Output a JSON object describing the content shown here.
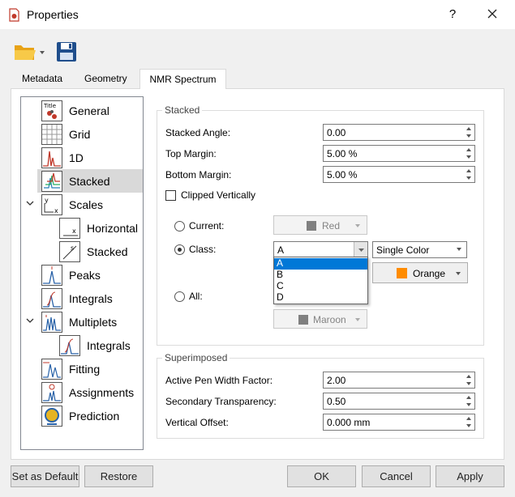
{
  "window": {
    "title": "Properties",
    "help": "?"
  },
  "tabs": [
    {
      "label": "Metadata"
    },
    {
      "label": "Geometry"
    },
    {
      "label": "NMR Spectrum"
    }
  ],
  "tree": {
    "items": [
      {
        "label": "General",
        "icon": "title-icon"
      },
      {
        "label": "Grid",
        "icon": "grid-icon"
      },
      {
        "label": "1D",
        "icon": "1d-spectrum-icon"
      },
      {
        "label": "Stacked",
        "icon": "stacked-icon"
      },
      {
        "label": "Scales",
        "icon": "scales-icon"
      },
      {
        "label": "Horizontal",
        "icon": "horizontal-scale-icon"
      },
      {
        "label": "Stacked",
        "icon": "stacked-scale-icon"
      },
      {
        "label": "Peaks",
        "icon": "peaks-icon"
      },
      {
        "label": "Integrals",
        "icon": "integrals-icon"
      },
      {
        "label": "Multiplets",
        "icon": "multiplets-icon"
      },
      {
        "label": "Integrals",
        "icon": "multiplet-integrals-icon"
      },
      {
        "label": "Fitting",
        "icon": "fitting-icon"
      },
      {
        "label": "Assignments",
        "icon": "assignments-icon"
      },
      {
        "label": "Prediction",
        "icon": "prediction-icon"
      }
    ]
  },
  "stacked": {
    "title": "Stacked",
    "angle_label": "Stacked Angle:",
    "angle_value": "0.00",
    "top_label": "Top Margin:",
    "top_value": "5.00 %",
    "bottom_label": "Bottom Margin:",
    "bottom_value": "5.00 %",
    "clipped_label": "Clipped Vertically",
    "current_label": "Current:",
    "current_color": "Red",
    "class_label": "Class:",
    "class_value": "A",
    "mode_value": "Single Color",
    "class_color": "Orange",
    "all_label": "All:",
    "all_color": "Maroon",
    "class_options": [
      "A",
      "B",
      "C",
      "D"
    ]
  },
  "superimposed": {
    "title": "Superimposed",
    "pen_label": "Active Pen Width Factor:",
    "pen_value": "2.00",
    "trans_label": "Secondary Transparency:",
    "trans_value": "0.50",
    "offset_label": "Vertical Offset:",
    "offset_value": "0.000 mm"
  },
  "buttons": {
    "default": "Set as Default",
    "restore": "Restore",
    "ok": "OK",
    "cancel": "Cancel",
    "apply": "Apply"
  },
  "colors": {
    "red_swatch": "#808080",
    "orange_swatch": "#ff8c00",
    "maroon_swatch": "#808080",
    "selection": "#0078d7"
  }
}
